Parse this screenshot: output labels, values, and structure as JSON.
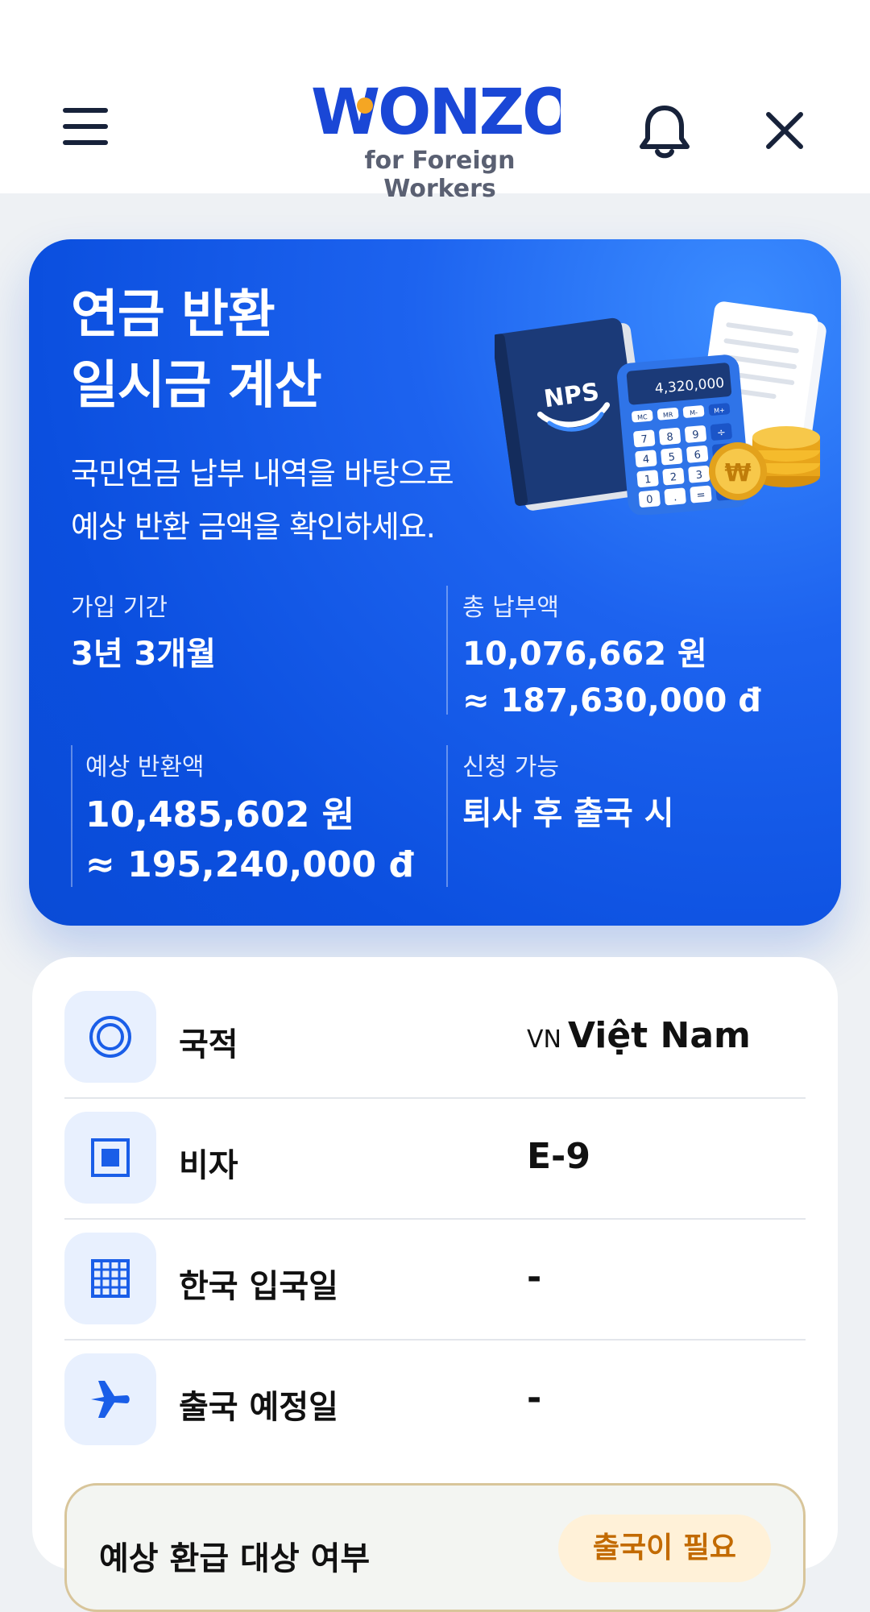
{
  "header": {
    "logo_text": "WONZO",
    "logo_subtitle": "for Foreign Workers",
    "menu_icon": "hamburger-icon",
    "bell_icon": "bell-icon",
    "close_icon": "close-icon"
  },
  "hero": {
    "title_line1": "연금 반환",
    "title_line2": "일시금 계산",
    "desc_line1": "국민연금 납부 내역을 바탕으로",
    "desc_line2": "예상 반환 금액을 확인하세요.",
    "illustration": {
      "book_label": "NPS",
      "calculator_display": "4,320,000",
      "calc_keys": [
        "MC",
        "MR",
        "M-",
        "M+",
        "7",
        "8",
        "9",
        "÷",
        "4",
        "5",
        "6",
        "×",
        "1",
        "2",
        "3",
        "-",
        "0",
        ".",
        "=",
        "+"
      ],
      "coin_symbol": "₩"
    },
    "stats": {
      "period_label": "가입 기간",
      "period_value": "3년 3개월",
      "total_label": "총 납부액",
      "total_krw": "10,076,662 원",
      "total_vnd": "≈ 187,630,000 đ",
      "expected_label": "예상 반환액",
      "expected_krw": "10,485,602 원",
      "expected_vnd": "≈ 195,240,000 đ",
      "apply_label": "신청 가능",
      "apply_value": "퇴사 후 출국 시"
    },
    "colors": {
      "primary": "#0b4fdf",
      "accent": "#3b8cff"
    }
  },
  "info": {
    "rows": [
      {
        "icon": "target-icon",
        "label": "국적",
        "country_code": "VN",
        "value": "Việt Nam"
      },
      {
        "icon": "stop-square-icon",
        "label": "비자",
        "value": "E-9"
      },
      {
        "icon": "calendar-grid-icon",
        "label": "한국 입국일",
        "value": "-"
      },
      {
        "icon": "airplane-icon",
        "label": "출국 예정일",
        "value": "-"
      }
    ],
    "return_eligibility": {
      "label": "예상 환급 대상 여부",
      "badge": "출국이 필요",
      "badge_color": "#c26a00"
    }
  }
}
